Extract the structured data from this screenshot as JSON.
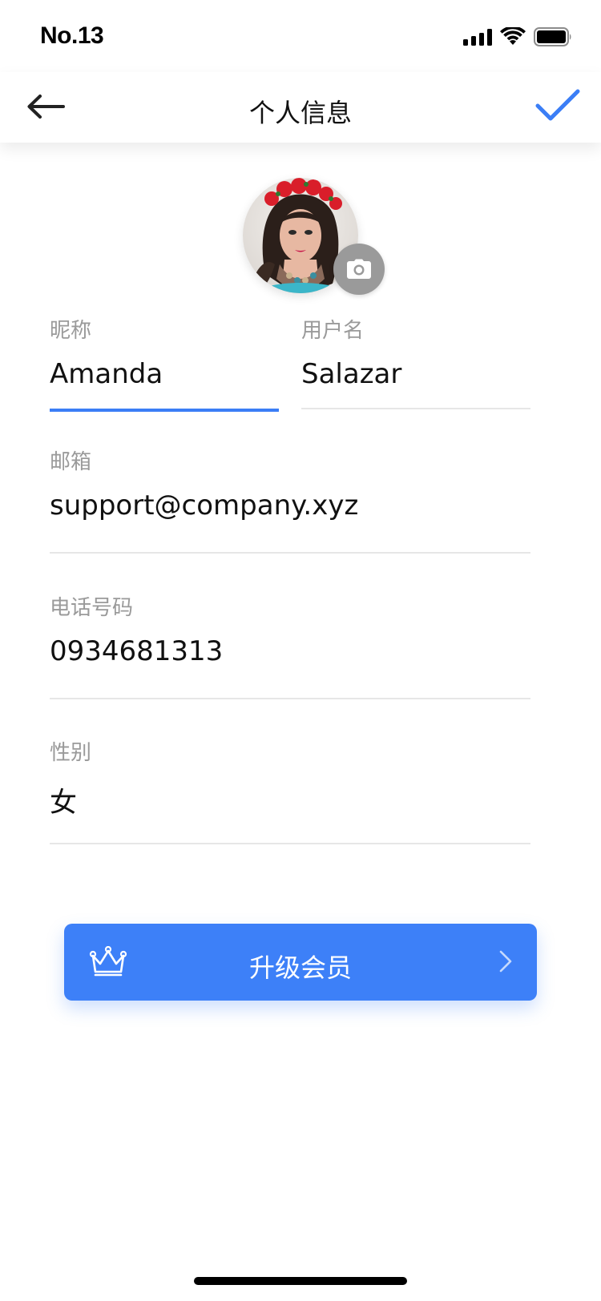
{
  "status_bar": {
    "carrier": "No.13",
    "icons": [
      "cellular-signal-icon",
      "wifi-icon",
      "battery-icon"
    ]
  },
  "nav": {
    "title": "个人信息",
    "back_icon": "arrow-left-icon",
    "confirm_icon": "checkmark-icon",
    "accent_color": "#3b7ef6"
  },
  "avatar": {
    "camera_icon": "camera-icon"
  },
  "form": {
    "nickname": {
      "label": "昵称",
      "value": "Amanda"
    },
    "username": {
      "label": "用户名",
      "value": "Salazar"
    },
    "email": {
      "label": "邮箱",
      "value": "support@company.xyz"
    },
    "phone": {
      "label": "电话号码",
      "value": "0934681313"
    },
    "gender": {
      "label": "性别",
      "value": "女"
    }
  },
  "upgrade": {
    "label": "升级会员",
    "icon": "crown-icon",
    "chevron": "chevron-right-icon",
    "color": "#3d80f8"
  }
}
